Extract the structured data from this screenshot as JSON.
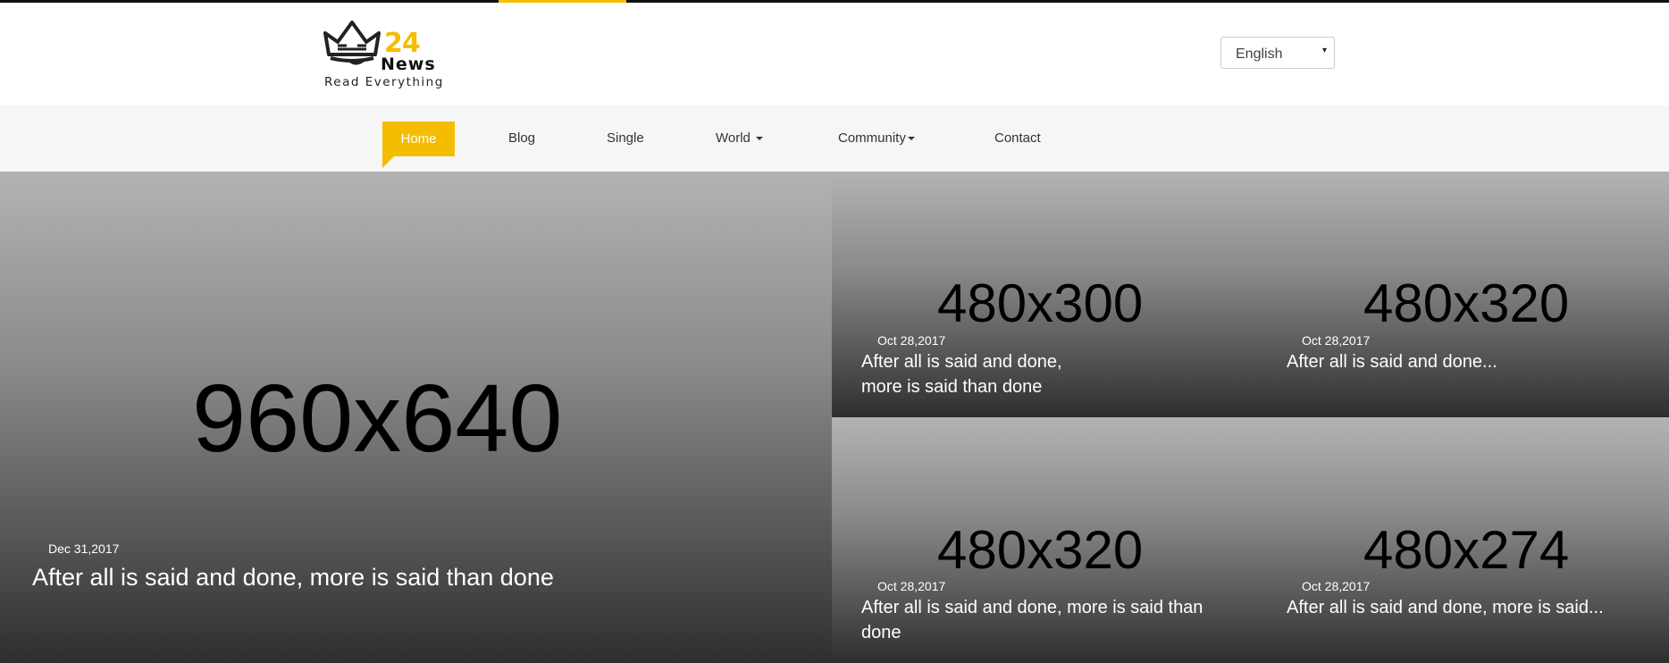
{
  "brand": {
    "logo_number": "24",
    "logo_word": "News",
    "tagline": "Read Everything",
    "accent_color": "#f5bd02"
  },
  "language_select": {
    "value": "English",
    "arrow": "▾"
  },
  "nav": {
    "items": [
      {
        "label": "Home",
        "active": true
      },
      {
        "label": "Blog"
      },
      {
        "label": "Single"
      },
      {
        "label": "World",
        "dropdown": true
      },
      {
        "label": "Community",
        "dropdown": true
      },
      {
        "label": "Contact"
      }
    ]
  },
  "featured": {
    "image_label": "960x640",
    "date": "Dec 31,2017",
    "title": "After all is said and done, more is said than done"
  },
  "grid_posts": [
    {
      "image_label": "480x300",
      "date": "Oct 28,2017",
      "title": "After all is said and done, more is said than done"
    },
    {
      "image_label": "480x320",
      "date": "Oct 28,2017",
      "title": "After all is said and done..."
    },
    {
      "image_label": "480x320",
      "date": "Oct 28,2017",
      "title": "After all is said and done, more is said than done"
    },
    {
      "image_label": "480x274",
      "date": "Oct 28,2017",
      "title": "After all is said and done, more is said..."
    }
  ]
}
